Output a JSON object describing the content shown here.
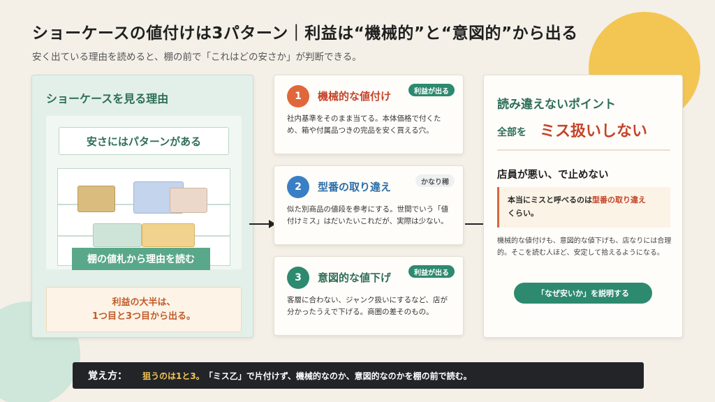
{
  "header": {
    "title": "ショーケースの値付けは3パターン｜利益は“機械的”と“意図的”から出る",
    "subtitle": "安く出ている理由を読めると、棚の前で「これはどの安さか」が判断できる。"
  },
  "left": {
    "title": "ショーケースを見る理由",
    "pattern_box": "安さにはパターンがある",
    "shelf_label": "棚の値札から理由を読む",
    "profit_line1": "利益の大半は、",
    "profit_line2": "1つ目と3つ目から出る。"
  },
  "cards": [
    {
      "num": "1",
      "title": "機械的な値付け",
      "badge": "利益が出る",
      "body": "社内基準をそのまま当てる。本体価格で付くため、箱や付属品つきの完品を安く買える穴。",
      "color": "#e0673a"
    },
    {
      "num": "2",
      "title": "型番の取り違え",
      "badge": "かなり稀",
      "body": "似た別商品の値段を参考にする。世間でいう「値付けミス」はだいたいこれだが、実際は少ない。",
      "color": "#3a7fc4"
    },
    {
      "num": "3",
      "title": "意図的な値下げ",
      "badge": "利益が出る",
      "body": "客層に合わない、ジャンク扱いにするなど、店が分かったうえで下げる。商圏の差そのもの。",
      "color": "#2d8a6e"
    }
  ],
  "right": {
    "heading": "読み違えないポイント",
    "sub_label": "全部を",
    "sub_emph": "ミス扱いしない",
    "h2": "店員が悪い、で止めない",
    "note_part1": "本当にミスと呼べるのは",
    "note_highlight": "型番の取り違え",
    "note_part2": "くらい。",
    "body": "機械的な値付けも、意図的な値下げも、店なりには合理的。そこを読む人ほど、安定して拾えるようになる。",
    "button": "「なぜ安いか」を説明する"
  },
  "bottom": {
    "label": "覚え方：",
    "highlight": "狙うのは1と3。",
    "text": "「ミス乙」で片付けず、機械的なのか、意図的なのかを棚の前で読む。"
  }
}
